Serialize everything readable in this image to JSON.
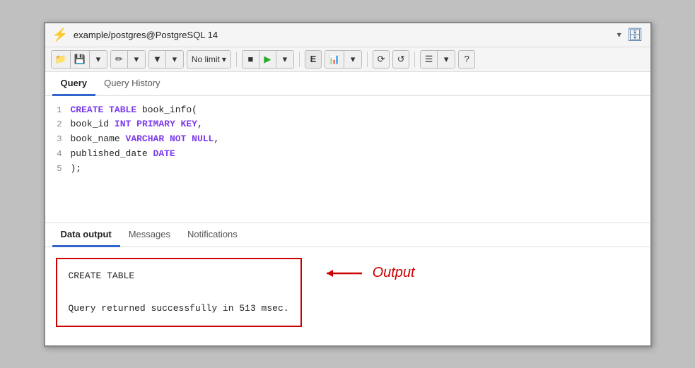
{
  "connection": {
    "icon": "🔗",
    "name": "example/postgres@PostgreSQL 14",
    "dropdown_icon": "▾",
    "db_icon": "🗄"
  },
  "toolbar": {
    "open_label": "📁",
    "save_label": "💾",
    "edit_label": "✏",
    "filter_label": "▼",
    "limit_label": "No limit",
    "stop_label": "■",
    "run_label": "▶",
    "explain_label": "E",
    "chart_label": "📊",
    "commit_label": "🔄",
    "rollback_label": "🔃",
    "macro_label": "☰",
    "help_label": "?"
  },
  "query_tabs": [
    {
      "label": "Query",
      "active": true
    },
    {
      "label": "Query History",
      "active": false
    }
  ],
  "sql_lines": [
    {
      "num": "1",
      "parts": [
        {
          "text": "CREATE TABLE ",
          "cls": "kw-create"
        },
        {
          "text": "book_info(",
          "cls": ""
        }
      ]
    },
    {
      "num": "2",
      "parts": [
        {
          "text": "book_id ",
          "cls": ""
        },
        {
          "text": "INT ",
          "cls": "kw-int"
        },
        {
          "text": "PRIMARY KEY",
          "cls": "kw-primary"
        },
        {
          "text": ",",
          "cls": ""
        }
      ]
    },
    {
      "num": "3",
      "parts": [
        {
          "text": "book_name ",
          "cls": ""
        },
        {
          "text": "VARCHAR ",
          "cls": "kw-varchar"
        },
        {
          "text": "NOT ",
          "cls": "kw-not"
        },
        {
          "text": "NULL",
          "cls": "kw-null"
        },
        {
          "text": ",",
          "cls": ""
        }
      ]
    },
    {
      "num": "4",
      "parts": [
        {
          "text": "published_date ",
          "cls": ""
        },
        {
          "text": "DATE",
          "cls": "kw-date"
        }
      ]
    },
    {
      "num": "5",
      "parts": [
        {
          "text": ");",
          "cls": ""
        }
      ]
    }
  ],
  "result_tabs": [
    {
      "label": "Data output",
      "active": true
    },
    {
      "label": "Messages",
      "active": false
    },
    {
      "label": "Notifications",
      "active": false
    }
  ],
  "output": {
    "line1": "CREATE TABLE",
    "line2": "",
    "line3": "Query returned successfully in 513 msec.",
    "arrow_label": "Output"
  }
}
